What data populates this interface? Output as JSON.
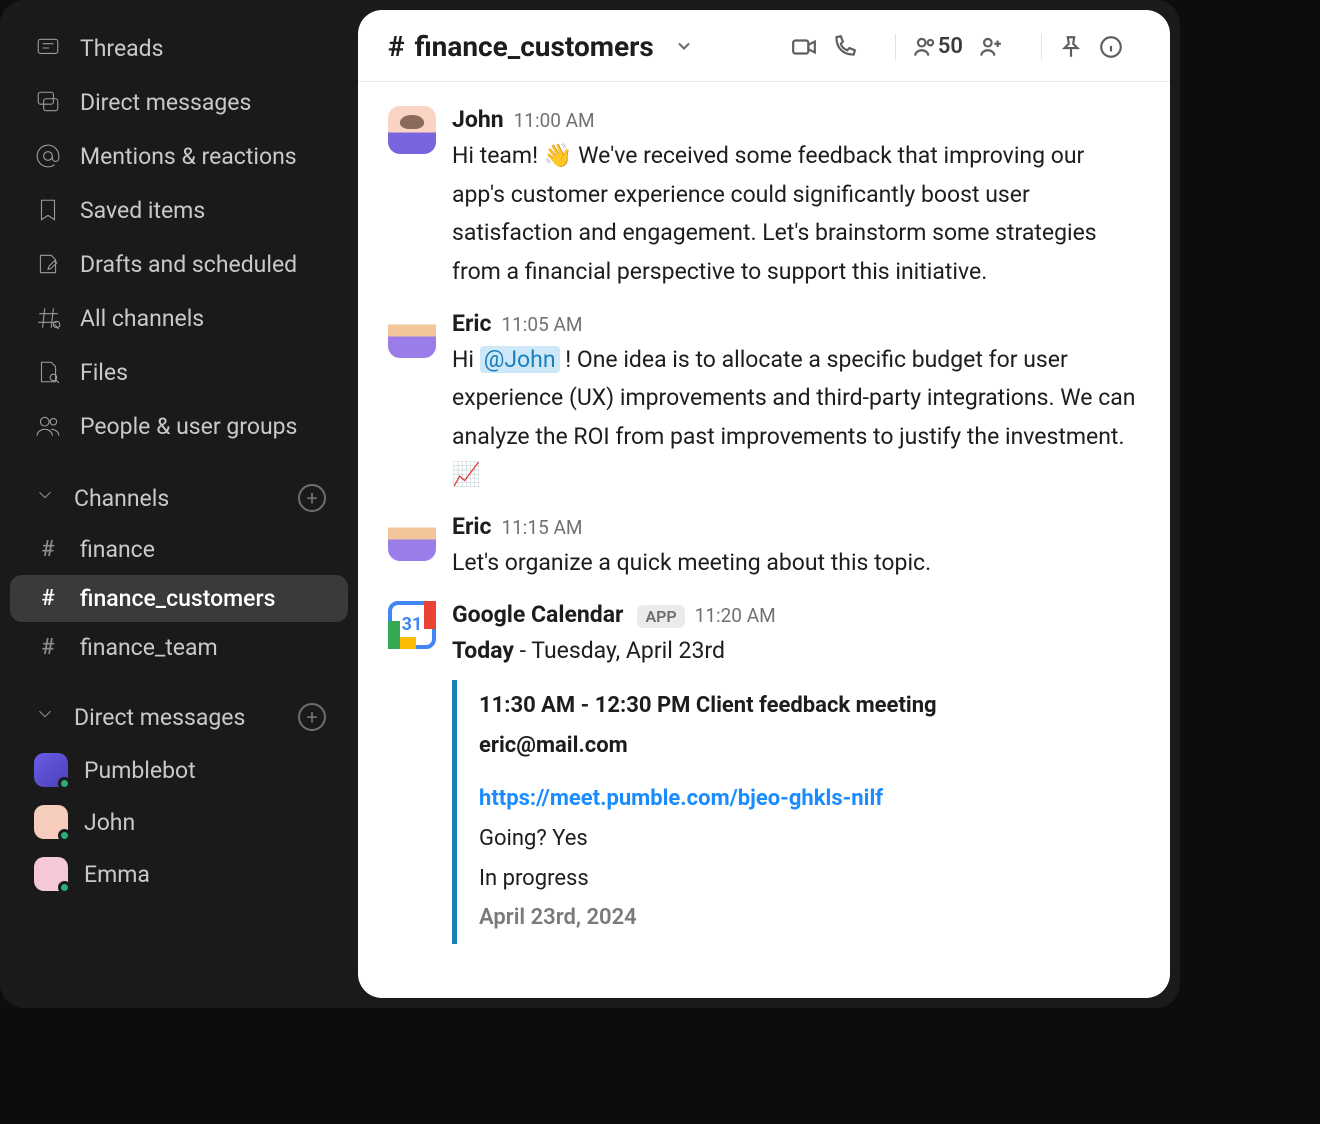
{
  "sidebar": {
    "nav": [
      {
        "label": "Threads",
        "icon": "threads"
      },
      {
        "label": "Direct messages",
        "icon": "dm"
      },
      {
        "label": "Mentions & reactions",
        "icon": "mentions"
      },
      {
        "label": "Saved items",
        "icon": "saved"
      },
      {
        "label": "Drafts and scheduled",
        "icon": "drafts"
      },
      {
        "label": "All channels",
        "icon": "channels"
      },
      {
        "label": "Files",
        "icon": "files"
      },
      {
        "label": "People & user groups",
        "icon": "people"
      }
    ],
    "channels_header": "Channels",
    "channels": [
      {
        "name": "finance",
        "active": false
      },
      {
        "name": "finance_customers",
        "active": true
      },
      {
        "name": "finance_team",
        "active": false
      }
    ],
    "dm_header": "Direct messages",
    "dms": [
      {
        "name": "Pumblebot",
        "avatar": "bot"
      },
      {
        "name": "John",
        "avatar": "john"
      },
      {
        "name": "Emma",
        "avatar": "emma"
      }
    ]
  },
  "header": {
    "channel_name": "finance_customers",
    "member_count": "50"
  },
  "messages": [
    {
      "author": "John",
      "time": "11:00 AM",
      "avatar": "john",
      "text_pre": "Hi team! ",
      "emoji": "👋",
      "text_post": " We've received some feedback that improving our app's customer experience could significantly boost user satisfaction and engagement. Let's brainstorm some strategies from a financial perspective to support this initiative."
    },
    {
      "author": "Eric",
      "time": "11:05 AM",
      "avatar": "eric",
      "text_pre": "Hi ",
      "mention": "@John",
      "text_mid": " ! One idea is to allocate a specific budget for user experience (UX) improvements and third-party integrations. We can analyze the ROI from past improvements to justify the investment. ",
      "emoji2": "📈"
    },
    {
      "author": "Eric",
      "time": "11:15 AM",
      "avatar": "eric",
      "text": "Let's organize a quick meeting about this topic."
    }
  ],
  "calendar": {
    "app_name": "Google Calendar",
    "app_badge": "APP",
    "time": "11:20 AM",
    "today_label": "Today",
    "date_text": " - Tuesday, April 23rd",
    "event_title": "11:30 AM - 12:30 PM Client feedback meeting",
    "event_email": "eric@mail.com",
    "event_link": "https://meet.pumble.com/bjeo-ghkls-nilf",
    "event_going": "Going? Yes",
    "event_status": "In progress",
    "event_date": "April 23rd, 2024"
  }
}
